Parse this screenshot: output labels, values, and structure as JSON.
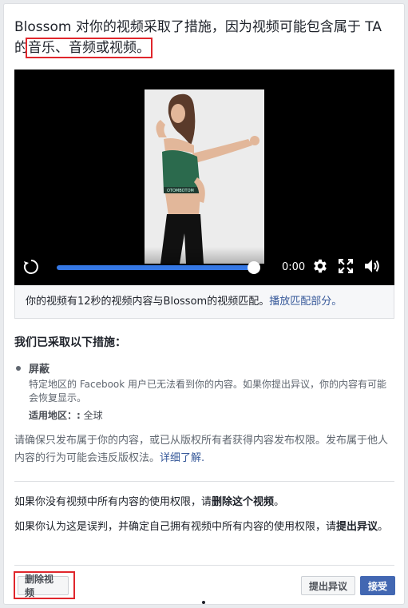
{
  "header": {
    "title_part1": "Blossom 对你的视频采取了措施，因为视频可能包含属于 TA 的",
    "title_highlight": "音乐、音频或视频。"
  },
  "player": {
    "time": "0:00",
    "progress": 1.0
  },
  "match": {
    "text": "你的视频有12秒的视频内容与Blossom的视频匹配。",
    "link": "播放匹配部分。"
  },
  "actions_section": {
    "heading": "我们已采取以下措施：",
    "item_title": "屏蔽",
    "item_desc": "特定地区的 Facebook 用户已无法看到你的内容。如果你提出异议，你的内容有可能会恢复显示。",
    "region_label": "适用地区：:",
    "region_value": "全球"
  },
  "copyright_note": {
    "text": "请确保只发布属于你的内容，或已从版权所有者获得内容发布权限。发布属于他人内容的行为可能会违反版权法。",
    "link": "详细了解."
  },
  "guidance": {
    "para1_prefix": "如果你没有视频中所有内容的使用权限，请",
    "para1_bold": "删除这个视频",
    "para1_suffix": "。",
    "para2_prefix": "如果你认为这是误判，并确定自己拥有视频中所有内容的使用权限，请",
    "para2_bold": "提出异议",
    "para2_suffix": "。"
  },
  "buttons": {
    "delete": "删除视频",
    "dispute": "提出异议",
    "accept": "接受"
  },
  "colors": {
    "accent": "#4267b2",
    "progress": "#3578e5",
    "highlight": "#e0262c",
    "link": "#365899"
  },
  "icons": [
    "replay-icon",
    "settings-icon",
    "fullscreen-icon",
    "volume-icon"
  ]
}
